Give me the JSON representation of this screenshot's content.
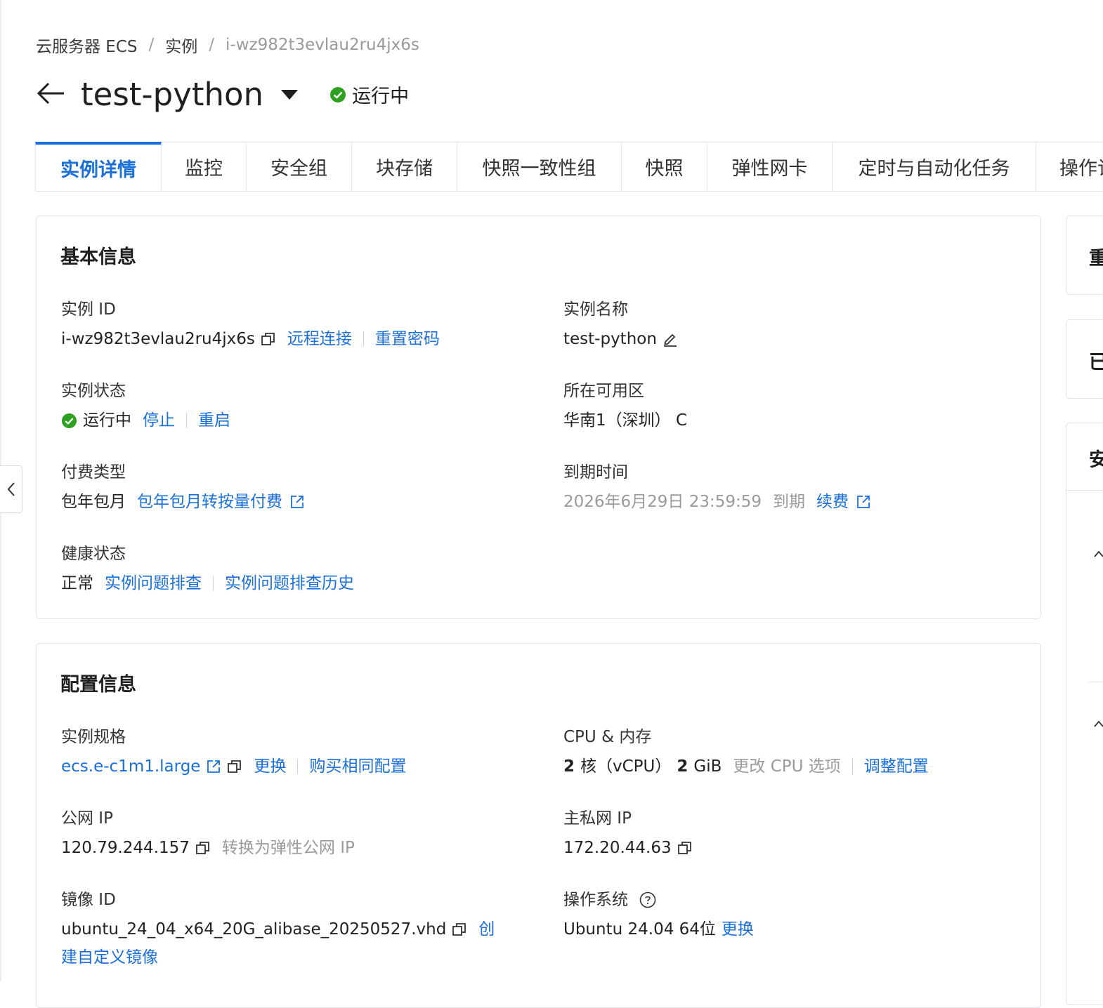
{
  "breadcrumb": {
    "items": [
      "云服务器 ECS",
      "实例",
      "i-wz982t3evlau2ru4jx6s"
    ],
    "separator": "/"
  },
  "header": {
    "title": "test-python",
    "status": "运行中",
    "status_color": "#2ea121"
  },
  "tabs": [
    "实例详情",
    "监控",
    "安全组",
    "块存储",
    "快照一致性组",
    "快照",
    "弹性网卡",
    "定时与自动化任务",
    "操作记录"
  ],
  "basic_info": {
    "title": "基本信息",
    "instance_id": {
      "label": "实例 ID",
      "value": "i-wz982t3evlau2ru4jx6s",
      "remote": "远程连接",
      "reset_pwd": "重置密码"
    },
    "instance_name": {
      "label": "实例名称",
      "value": "test-python"
    },
    "instance_status": {
      "label": "实例状态",
      "value": "运行中",
      "stop": "停止",
      "restart": "重启"
    },
    "zone": {
      "label": "所在可用区",
      "value": "华南1（深圳） C"
    },
    "billing": {
      "label": "付费类型",
      "value": "包年包月",
      "convert": "包年包月转按量付费"
    },
    "expire": {
      "label": "到期时间",
      "value": "2026年6月29日 23:59:59",
      "suffix": "到期",
      "renew": "续费"
    },
    "health": {
      "label": "健康状态",
      "value": "正常",
      "troubleshoot": "实例问题排查",
      "history": "实例问题排查历史"
    }
  },
  "config_info": {
    "title": "配置信息",
    "spec": {
      "label": "实例规格",
      "value": "ecs.e-c1m1.large",
      "change": "更换",
      "buy_same": "购买相同配置"
    },
    "cpu_mem": {
      "label": "CPU & 内存",
      "cpu_num": "2",
      "cpu_unit": "核（vCPU）",
      "mem_num": "2",
      "mem_unit": "GiB",
      "change_cpu": "更改 CPU 选项",
      "adjust": "调整配置"
    },
    "public_ip": {
      "label": "公网 IP",
      "value": "120.79.244.157",
      "convert": "转换为弹性公网 IP"
    },
    "private_ip": {
      "label": "主私网 IP",
      "value": "172.20.44.63"
    },
    "image": {
      "label": "镜像 ID",
      "value": "ubuntu_24_04_x64_20G_alibase_20250527.vhd",
      "create_part1": "创",
      "create_part2": "建自定义镜像"
    },
    "os": {
      "label": "操作系统",
      "value": "Ubuntu 24.04 64位",
      "change": "更换"
    }
  },
  "side": {
    "card1": "重",
    "card2": "已",
    "card3": "安"
  },
  "colors": {
    "link": "#1a6fd9",
    "muted": "#9a9a9a",
    "success": "#2ea121",
    "border": "#e1e3e7"
  },
  "icons": [
    "back-arrow-icon",
    "caret-down-icon",
    "check-circle-icon",
    "copy-icon",
    "edit-icon",
    "external-link-icon",
    "help-icon",
    "chevron-left-icon",
    "chevron-up-icon"
  ]
}
